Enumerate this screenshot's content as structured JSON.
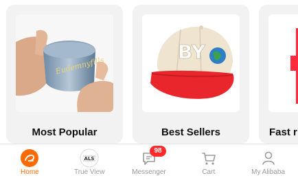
{
  "categories": [
    {
      "label": "Most Popular",
      "thumb_icon": "tin-can-product-image",
      "thumb_text": "Eudemnyfills"
    },
    {
      "label": "Best Sellers",
      "thumb_icon": "baseball-cap-product-image",
      "thumb_text": "BY"
    },
    {
      "label": "Fast r",
      "thumb_icon": "product-image"
    }
  ],
  "tabbar": {
    "tabs": [
      {
        "label": "Home",
        "icon": "alibaba-home-icon",
        "active": true
      },
      {
        "label": "True View",
        "icon": "als-icon",
        "icon_text": "ALS"
      },
      {
        "label": "Messenger",
        "icon": "message-icon",
        "badge": "98"
      },
      {
        "label": "Cart",
        "icon": "cart-icon"
      },
      {
        "label": "My Alibaba",
        "icon": "person-icon"
      }
    ]
  },
  "colors": {
    "accent": "#ff6a00",
    "badge": "#ff2b2b",
    "card_bg": "#f2f2f2",
    "cap_red": "#e8262b",
    "cap_cream": "#efe4cf"
  }
}
